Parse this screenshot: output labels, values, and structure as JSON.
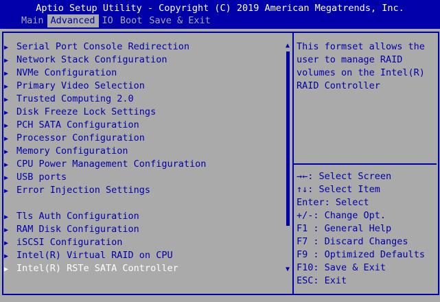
{
  "title": "Aptio Setup Utility - Copyright (C) 2019 American Megatrends, Inc.",
  "tabs": [
    {
      "label": "Main"
    },
    {
      "label": "Advanced"
    },
    {
      "label": "IO"
    },
    {
      "label": "Boot"
    },
    {
      "label": "Save & Exit"
    }
  ],
  "active_tab": "Advanced",
  "menu": {
    "group1": [
      {
        "label": "Serial Port Console Redirection"
      },
      {
        "label": "Network Stack Configuration"
      },
      {
        "label": "NVMe Configuration"
      },
      {
        "label": "Primary Video Selection"
      },
      {
        "label": "Trusted Computing 2.0"
      },
      {
        "label": "Disk Freeze Lock Settings"
      },
      {
        "label": "PCH SATA Configuration"
      },
      {
        "label": "Processor Configuration"
      },
      {
        "label": "Memory Configuration"
      },
      {
        "label": "CPU Power Management Configuration"
      },
      {
        "label": "USB ports"
      },
      {
        "label": "Error Injection Settings"
      }
    ],
    "group2": [
      {
        "label": "Tls Auth Configuration"
      },
      {
        "label": "RAM Disk Configuration"
      },
      {
        "label": "iSCSI Configuration"
      },
      {
        "label": "Intel(R) Virtual RAID on CPU"
      },
      {
        "label": "Intel(R) RSTe SATA Controller"
      }
    ],
    "selected": "Intel(R) RSTe SATA Controller"
  },
  "help_text": "This formset allows the\nuser to manage RAID\nvolumes on the Intel(R)\nRAID Controller",
  "keys": [
    {
      "key": "→←",
      "desc": ": Select Screen"
    },
    {
      "key": "↑↓",
      "desc": ": Select Item"
    },
    {
      "key": "Enter",
      "desc": ": Select"
    },
    {
      "key": "+/-",
      "desc": ": Change Opt."
    },
    {
      "key": "F1 ",
      "desc": ": General Help"
    },
    {
      "key": "F7 ",
      "desc": ": Discard Changes"
    },
    {
      "key": "F9 ",
      "desc": ": Optimized Defaults"
    },
    {
      "key": "F10",
      "desc": ": Save & Exit"
    },
    {
      "key": "ESC",
      "desc": ": Exit"
    }
  ],
  "colors": {
    "background": "#aaaaaa",
    "accent": "#0000aa",
    "selected_text": "#ffffff"
  }
}
